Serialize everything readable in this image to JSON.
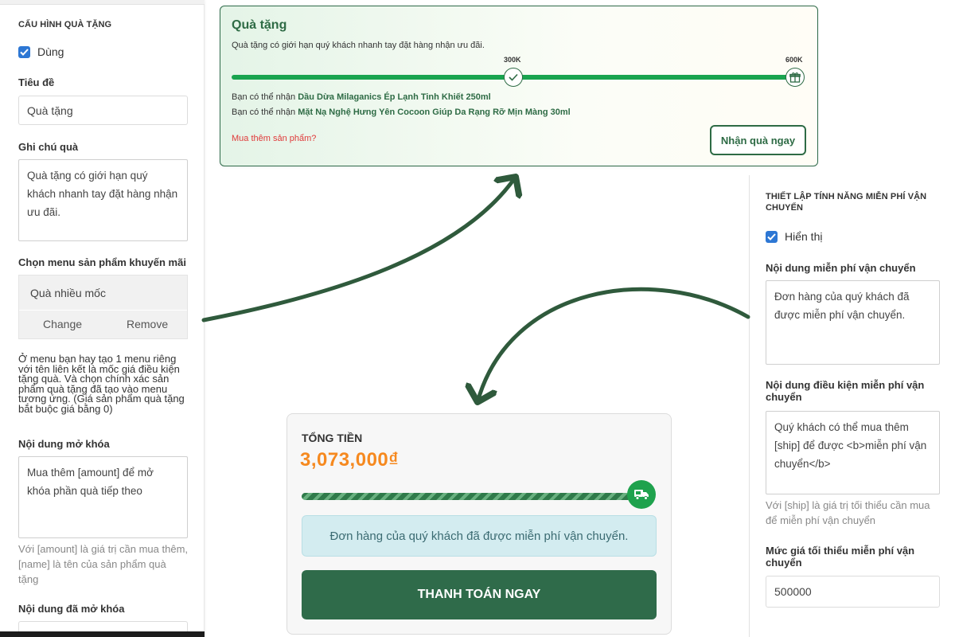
{
  "left_panel": {
    "section_title": "CẤU HÌNH QUÀ TẶNG",
    "enable_label": "Dùng",
    "title_label": "Tiêu đề",
    "title_value": "Quà tặng",
    "note_label": "Ghi chú quà",
    "note_value": "Quà tặng có giới hạn quý khách nhanh tay đặt hàng nhận ưu đãi.",
    "menu_label": "Chọn menu sản phẩm khuyến mãi",
    "menu_value": "Quà nhiều mốc",
    "change_label": "Change",
    "remove_label": "Remove",
    "menu_help": "Ở menu bạn hay tạo 1 menu riêng với tên liên kết là mốc giá điều kiện tặng quà. Và chọn chính xác sản phẩm quà tặng đã tạo vào menu tương ứng. (Giá sản phẩm quà tặng bắt buộc giá bằng 0)",
    "unlock_label": "Nội dung mở khóa",
    "unlock_value": "Mua thêm [amount] để mở khóa phần quà tiếp theo",
    "unlock_help": "Với [amount] là giá trị cần mua thêm, [name] là tên của sản phẩm quà tặng",
    "unlocked_label": "Nội dung đã mở khóa"
  },
  "gift_card": {
    "title": "Quà tặng",
    "subtitle": "Quà tặng có giới hạn quý khách nhanh tay đặt hàng nhận ưu đãi.",
    "milestone_1": "300K",
    "milestone_2": "600K",
    "progress": 1.0,
    "line1_prefix": "Bạn có thể nhận",
    "line1_product": "Dầu Dừa Milaganics Ép Lạnh Tinh Khiết 250ml",
    "line2_prefix": "Bạn có thể nhận",
    "line2_product": "Mặt Nạ Nghệ Hưng Yên Cocoon Giúp Da Rạng Rỡ Mịn Màng 30ml",
    "more_link": "Mua thêm sản phẩm?",
    "claim_button": "Nhận quà ngay"
  },
  "total_card": {
    "label": "TỔNG TIỀN",
    "amount": "3,073,000₫",
    "progress": 1.0,
    "free_shipping_msg": "Đơn hàng của quý khách đã được miễn phí vận chuyển.",
    "pay_button": "THANH TOÁN NGAY"
  },
  "right_panel": {
    "section_title": "THIẾT LẬP TÍNH NĂNG MIỄN PHÍ VẬN CHUYỂN",
    "show_label": "Hiển thị",
    "free_content_label": "Nội dung miễn phí vận chuyển",
    "free_content_value": "Đơn hàng của quý khách đã được miễn phí vận chuyển.",
    "condition_label": "Nội dung điều kiện miễn phí vận chuyển",
    "condition_value": "Quý khách có thể mua thêm [ship] để được <b>miễn phí vận chuyển</b>",
    "condition_help": "Với [ship] là giá trị tối thiểu cần mua để miễn phí vận chuyển",
    "min_label": "Mức giá tối thiểu miễn phí vận chuyển",
    "min_value": "500000"
  },
  "colors": {
    "brand_green": "#2f6b4a",
    "progress_green": "#19a44f",
    "amount_orange": "#f6891f",
    "checkbox_blue": "#2d77d4",
    "link_red": "#e03a3a"
  }
}
